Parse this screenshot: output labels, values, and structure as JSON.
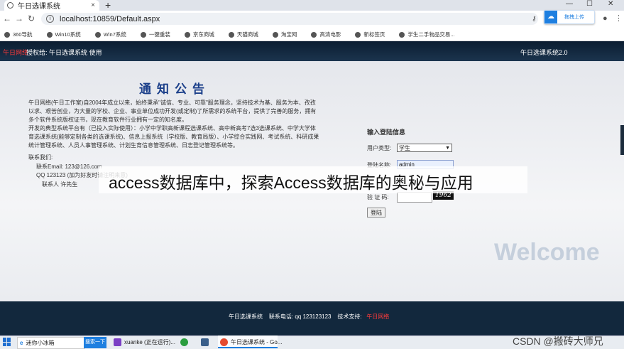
{
  "browser": {
    "tab_title": "午日选课系统",
    "tab_close": "×",
    "new_tab": "+",
    "win_min": "—",
    "win_max": "☐",
    "win_close": "✕",
    "url": "localhost:10859/Default.aspx",
    "upload_label": "拖拽上传",
    "bookmarks": [
      "360导航",
      "Win10系统",
      "Win7系统",
      "一键重装",
      "京东商城",
      "天猫商城",
      "淘宝网",
      "高清电影",
      "新标签页",
      "学生二手物品交易..."
    ]
  },
  "site": {
    "brand_badge": "午日网络",
    "auth_label": "授权给:  午日选课系统 使用",
    "version": "午日选课系统2.0"
  },
  "notice": {
    "title": "通知公告",
    "paragraphs": [
      "午日网络(午日工作室)自2004年成立以来，始终秉承\"诚信、专业、可靠\"服务理念，坚持技术为基、服务为本、孜孜以求、艰苦创业，为大量的学校、企业、事业单位成功开发(或定制)了所需求的系统平台，提供了完善的服务，拥有多个软件系统版权证书，现在教育软件行业拥有一定的知名度。",
      "开发的典型系统平台有（已投入实际使用）：小学中学职高新课程选课系统、高中新高考7选3选课系统、中学大学体育选课系统(能够定制各类的选课系统)、信息上报系统（学校版、教育局版）、小学综合实践网、考试系统、科研成果统计管理系统、人员人事管理系统、计划生育信息管理系统、日志登记管理系统等。"
    ],
    "contact_title": "联系我们:",
    "email": "联系Email: 123@126.com",
    "qq": "QQ 123123  (加为好友时请注明来意)",
    "person": "联系人 许先生"
  },
  "login": {
    "title": "输入登陆信息",
    "usertype_label": "用户类型:",
    "usertype_value": "学生",
    "username_label": "登陆名称:",
    "username_value": "admin",
    "captcha_label": "验 证 码:",
    "captcha_code": "1962",
    "button": "登陆",
    "welcome": "Welcome"
  },
  "banner": {
    "text": "access数据库中，探索Access数据库的奥秘与应用"
  },
  "footer": {
    "system": "午日选课系统",
    "phone": "联系电话: qq 123123123",
    "support": "技术支持:",
    "support_name": "午日网络"
  },
  "taskbar": {
    "search_text": "迷你小冰箱",
    "search_button": "搜索一下",
    "vs_item": "xuanke (正在运行)...",
    "chrome_item": "午日选课系统 - Go..."
  },
  "watermark": "CSDN @搬砖大师兄"
}
